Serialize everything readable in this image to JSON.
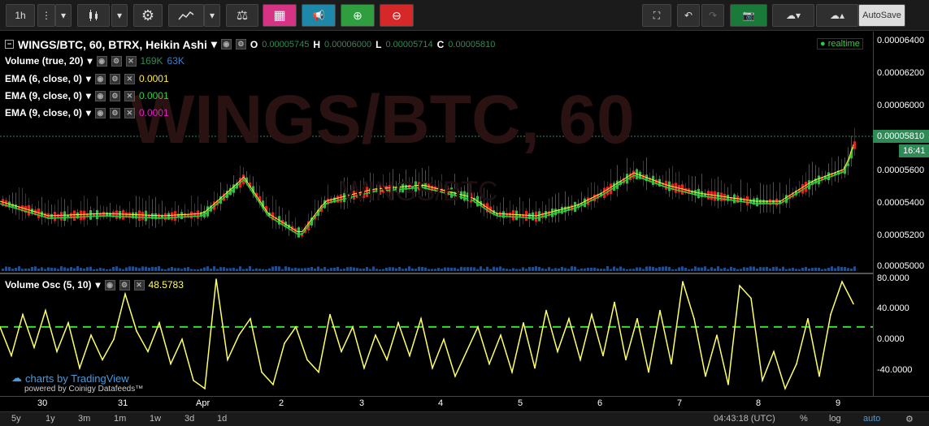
{
  "toolbar": {
    "interval": "1h",
    "autosave": "AutoSave"
  },
  "main": {
    "title": "WINGS/BTC, 60, BTRX, Heikin Ashi",
    "watermark": "WINGS/BTC, 60",
    "watermark_sub": "WINGS/BTC",
    "ohlc": {
      "o_label": "O",
      "o": "0.00005745",
      "h_label": "H",
      "h": "0.00006000",
      "l_label": "L",
      "l": "0.00005714",
      "c_label": "C",
      "c": "0.00005810"
    },
    "realtime": "realtime",
    "indicators": [
      {
        "label": "Volume (true, 20)",
        "value": "169K",
        "value2": "63K",
        "color": "#2e8b57",
        "color2": "#3a7fcf"
      },
      {
        "label": "EMA (6, close, 0)",
        "value": "0.0001",
        "color": "#ffeb3b"
      },
      {
        "label": "EMA (9, close, 0)",
        "value": "0.0001",
        "color": "#2ecc40"
      },
      {
        "label": "EMA (9, close, 0)",
        "value": "0.0001",
        "color": "#e020c0"
      }
    ],
    "price_ticks": [
      "0.00006400",
      "0.00006200",
      "0.00006000",
      "0.00005600",
      "0.00005400",
      "0.00005200",
      "0.00005000"
    ],
    "last_price": "0.00005810",
    "time_tag": "16:41"
  },
  "osc": {
    "label": "Volume Osc (5, 10)",
    "value": "48.5783",
    "ticks": [
      "80.0000",
      "40.0000",
      "0.0000",
      "-40.0000"
    ]
  },
  "branding": {
    "line1": "charts by TradingView",
    "line2": "powered by Coinigy Datafeeds™"
  },
  "xaxis": [
    "30",
    "31",
    "Apr",
    "2",
    "3",
    "4",
    "5",
    "6",
    "7",
    "8",
    "9"
  ],
  "bottom": {
    "ranges": [
      "5y",
      "1y",
      "3m",
      "1m",
      "1w",
      "3d",
      "1d"
    ],
    "clock": "04:43:18 (UTC)",
    "pct": "%",
    "log": "log",
    "auto": "auto"
  },
  "colors": {
    "up": "#3cb44b",
    "down": "#e02424",
    "ema6": "#ffeb3b",
    "ema9": "#2ecc40",
    "osc": "#ffff66",
    "zero": "#33dd33"
  },
  "chart_data": {
    "type": "line",
    "series": [
      {
        "name": "Volume Osc (5, 10)",
        "values": [
          20,
          -15,
          35,
          -5,
          40,
          -10,
          25,
          -30,
          10,
          -20,
          5,
          60,
          15,
          -10,
          25,
          -25,
          5,
          -45,
          -55,
          78,
          -20,
          10,
          30,
          -35,
          -50,
          0,
          20,
          -20,
          -35,
          35,
          -10,
          20,
          -30,
          10,
          -20,
          25,
          -15,
          30,
          -30,
          5,
          -40,
          -10,
          20,
          -25,
          10,
          -35,
          25,
          -30,
          40,
          -10,
          30,
          -20,
          35,
          -15,
          50,
          -20,
          30,
          -35,
          40,
          -25,
          75,
          30,
          -40,
          10,
          -50,
          70,
          55,
          -45,
          -10,
          -55,
          -25,
          30,
          -40,
          35,
          75,
          48
        ]
      }
    ],
    "ylim": [
      -60,
      80
    ],
    "ylabel": ""
  }
}
